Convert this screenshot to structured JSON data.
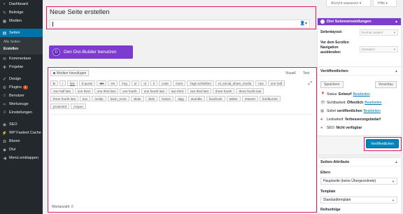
{
  "sidebar": {
    "items": [
      {
        "icon": "dashboard-icon",
        "glyph": "◐",
        "label": "Dashboard"
      },
      {
        "icon": "pin-icon",
        "glyph": "✎",
        "label": "Beiträge"
      },
      {
        "icon": "media-icon",
        "glyph": "▣",
        "label": "Medien"
      },
      {
        "icon": "pages-icon",
        "glyph": "▤",
        "label": "Seiten"
      },
      {
        "icon": "comments-icon",
        "glyph": "✉",
        "label": "Kommentare"
      },
      {
        "icon": "projects-icon",
        "glyph": "✚",
        "label": "Projekte"
      },
      {
        "icon": "design-icon",
        "glyph": "✐",
        "label": "Design"
      },
      {
        "icon": "plugins-icon",
        "glyph": "⚙",
        "label": "Plugins",
        "badge": "4"
      },
      {
        "icon": "users-icon",
        "glyph": "☺",
        "label": "Benutzer"
      },
      {
        "icon": "tools-icon",
        "glyph": "✂",
        "label": "Werkzeuge"
      },
      {
        "icon": "settings-icon",
        "glyph": "≡",
        "label": "Einstellungen"
      },
      {
        "icon": "seo-icon",
        "glyph": "◉",
        "label": "SEO"
      },
      {
        "icon": "cache-icon",
        "glyph": "⚡",
        "label": "WP Fastest Cache"
      },
      {
        "icon": "bloom-icon",
        "glyph": "✿",
        "label": "Bloom"
      },
      {
        "icon": "divi-icon",
        "glyph": "◆",
        "label": "Divi"
      },
      {
        "icon": "collapse-icon",
        "glyph": "◀",
        "label": "Menü einklappen"
      }
    ],
    "sub_items": [
      "Alle Seiten",
      "Erstellen"
    ]
  },
  "top": {
    "screen_options": "Ansicht anpassen ▾",
    "help": "Hilfe ▾"
  },
  "title": {
    "heading": "Neue Seite erstellen",
    "person_icon": "person-icon"
  },
  "divi_builder": {
    "label": "Den Divi-Builder benutzen",
    "letter": "D"
  },
  "editor": {
    "media_button": "Medien hinzufügen",
    "tab_visual": "Visuell",
    "tab_text": "Text",
    "row1": [
      "b",
      "i",
      "link",
      "b-quote",
      "del",
      "ins",
      "img",
      "ul",
      "ol",
      "li",
      "code",
      "more",
      "Tags schließen",
      "et_social_share_media",
      "raw",
      "one half"
    ],
    "row2": [
      "one half last",
      "one third",
      "one third last",
      "one fourth",
      "one fourth last",
      "two third",
      "two third last",
      "three fourth",
      "three fourth last"
    ],
    "row3": [
      "three fourth last",
      "box",
      "tooltip",
      "learn_more",
      "slider",
      "slide",
      "button",
      "digg",
      "stumble",
      "facebook",
      "twitter",
      "retweet",
      "feedburner"
    ],
    "row4": [
      "protected",
      "crayon"
    ],
    "word_count": "Wortanzahl: 0"
  },
  "divi_settings": {
    "title": "Divi Seiteneinstellungen",
    "layout_label": "Seitenlayout:",
    "layout_value": "Rechte Seitenl",
    "nav_label": "Vor dem Scrollen Navigation ausblenden:",
    "nav_value": "Standard"
  },
  "publish": {
    "title": "Veröffentlichen",
    "save": "Speichern",
    "preview": "Vorschau",
    "status_label": "Status:",
    "status_value": "Entwurf",
    "visibility_label": "Sichtbarkeit:",
    "visibility_value": "Öffentlich",
    "schedule_label": "Sofort",
    "schedule_value": "veröffentlichen",
    "edit_link": "Bearbeiten",
    "readability_label": "Lesbarkeit:",
    "readability_value": "Verbesserungsbedarf",
    "seo_label": "SEO:",
    "seo_value": "Nicht verfügbar",
    "publish_button": "Veröffentlichen"
  },
  "attributes": {
    "title": "Seiten-Attribute",
    "parent_label": "Eltern",
    "parent_value": "Hauptseite (keine Übergeordnete)",
    "template_label": "Template",
    "template_value": "Standardtemplate",
    "order_label": "Reihenfolge"
  },
  "colors": {
    "highlight": "#e21869",
    "divi_purple": "#7e3bd0",
    "wp_blue": "#0073aa",
    "sidebar": "#23282d"
  }
}
